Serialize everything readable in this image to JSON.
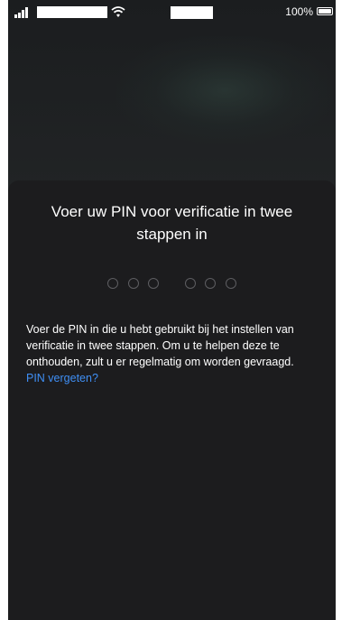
{
  "status_bar": {
    "battery_percent": "100%",
    "signal_icon": "cellular-signal-icon",
    "wifi_icon": "wifi-icon",
    "battery_icon": "battery-icon"
  },
  "sheet": {
    "title": "Voer uw PIN voor verificatie in twee stappen in",
    "pin_length": 6,
    "pin_entered": 0,
    "description": "Voer de PIN in die u hebt gebruikt bij het instellen van verificatie in twee stappen. Om u te helpen deze te onthouden, zult u er regelmatig om worden gevraagd.",
    "forgot_pin_link": "PIN vergeten?"
  },
  "colors": {
    "sheet_background": "#1c1c1e",
    "link": "#3f8ff5",
    "pin_dot_border": "#5d5d61"
  }
}
